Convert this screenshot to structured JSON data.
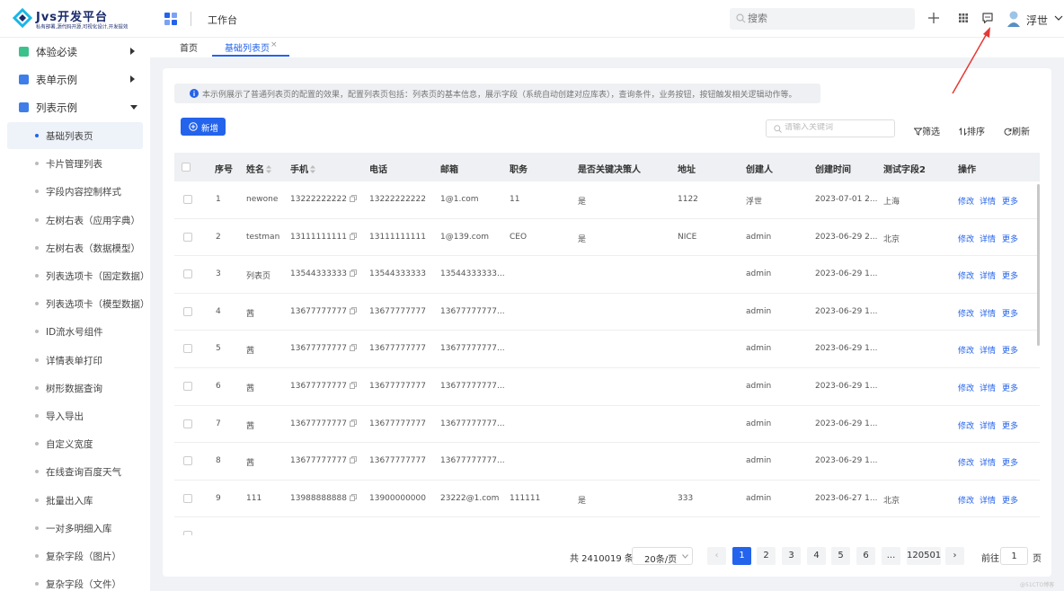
{
  "brand": {
    "title": "Jvs开发平台",
    "subtitle": "私有部署,源代码开源,可视化设计,开发提效",
    "colors": {
      "primary": "#2463eb",
      "dark": "#1a2a6c",
      "cyan": "#18b6e6"
    }
  },
  "header": {
    "page_title": "工作台",
    "search_placeholder": "搜索",
    "icons": [
      "menu-grid-icon",
      "plus-icon",
      "apps-grid-icon",
      "message-icon"
    ],
    "user_name": "浮世"
  },
  "sidebar": {
    "groups": [
      {
        "label": "体验必读",
        "icon": "book-icon",
        "expanded": false,
        "color": "#3cc18c"
      },
      {
        "label": "表单示例",
        "icon": "folder-icon",
        "expanded": false,
        "color": "#3f7ee8"
      },
      {
        "label": "列表示例",
        "icon": "list-icon",
        "expanded": true,
        "color": "#3f7ee8"
      }
    ],
    "items": [
      "基础列表页",
      "卡片管理列表",
      "字段内容控制样式",
      "左树右表（应用字典）",
      "左树右表（数据模型）",
      "列表选项卡（固定数据）",
      "列表选项卡（模型数据）",
      "ID流水号组件",
      "详情表单打印",
      "树形数据查询",
      "导入导出",
      "自定义宽度",
      "在线查询百度天气",
      "批量出入库",
      "一对多明细入库",
      "复杂字段（图片）",
      "复杂字段（文件）"
    ],
    "active_item": "基础列表页"
  },
  "tabs": [
    {
      "label": "首页",
      "active": false
    },
    {
      "label": "基础列表页",
      "active": true,
      "closable": true
    }
  ],
  "info_text": "本示例展示了普通列表页的配置的效果，配置列表页包括：列表页的基本信息，展示字段（系统自动创建对应库表），查询条件，业务按钮，按钮触发相关逻辑动作等。",
  "toolbar": {
    "new_label": "新增",
    "keyword_placeholder": "请输入关键词",
    "filter_label": "筛选",
    "sort_label": "排序",
    "refresh_label": "刷新"
  },
  "table": {
    "columns": [
      "序号",
      "姓名",
      "手机",
      "电话",
      "邮箱",
      "职务",
      "是否关键决策人",
      "地址",
      "创建人",
      "创建时间",
      "测试字段2",
      "操作"
    ],
    "sortable": [
      "姓名",
      "手机"
    ],
    "actions": [
      "修改",
      "详情",
      "更多"
    ],
    "rows": [
      [
        "1",
        "newone",
        "13222222222",
        "13222222222",
        "1@1.com",
        "11",
        "是",
        "1122",
        "浮世",
        "2023-07-01 2...",
        "上海"
      ],
      [
        "2",
        "testman",
        "13111111111",
        "13111111111",
        "1@139.com",
        "CEO",
        "是",
        "NICE",
        "admin",
        "2023-06-29 2...",
        "北京"
      ],
      [
        "3",
        "列表页",
        "13544333333",
        "13544333333",
        "13544333333...",
        "",
        "",
        "",
        "admin",
        "2023-06-29 1...",
        ""
      ],
      [
        "4",
        "茜",
        "13677777777",
        "13677777777",
        "13677777777...",
        "",
        "",
        "",
        "admin",
        "2023-06-29 1...",
        ""
      ],
      [
        "5",
        "茜",
        "13677777777",
        "13677777777",
        "13677777777...",
        "",
        "",
        "",
        "admin",
        "2023-06-29 1...",
        ""
      ],
      [
        "6",
        "茜",
        "13677777777",
        "13677777777",
        "13677777777...",
        "",
        "",
        "",
        "admin",
        "2023-06-29 1...",
        ""
      ],
      [
        "7",
        "茜",
        "13677777777",
        "13677777777",
        "13677777777...",
        "",
        "",
        "",
        "admin",
        "2023-06-29 1...",
        ""
      ],
      [
        "8",
        "茜",
        "13677777777",
        "13677777777",
        "13677777777...",
        "",
        "",
        "",
        "admin",
        "2023-06-29 1...",
        ""
      ],
      [
        "9",
        "111",
        "13988888888",
        "13900000000",
        "23222@1.com",
        "111111",
        "是",
        "333",
        "admin",
        "2023-06-27 1...",
        "北京"
      ]
    ]
  },
  "pagination": {
    "total_text": "共 2410019 条",
    "page_size": "20条/页",
    "pages": [
      "1",
      "2",
      "3",
      "4",
      "5",
      "6",
      "...",
      "120501"
    ],
    "current_page": "1",
    "goto_label": "前往",
    "goto_value": "1",
    "unit": "页",
    "prev": "‹",
    "next": "›"
  },
  "watermark": "@51CTO博客"
}
